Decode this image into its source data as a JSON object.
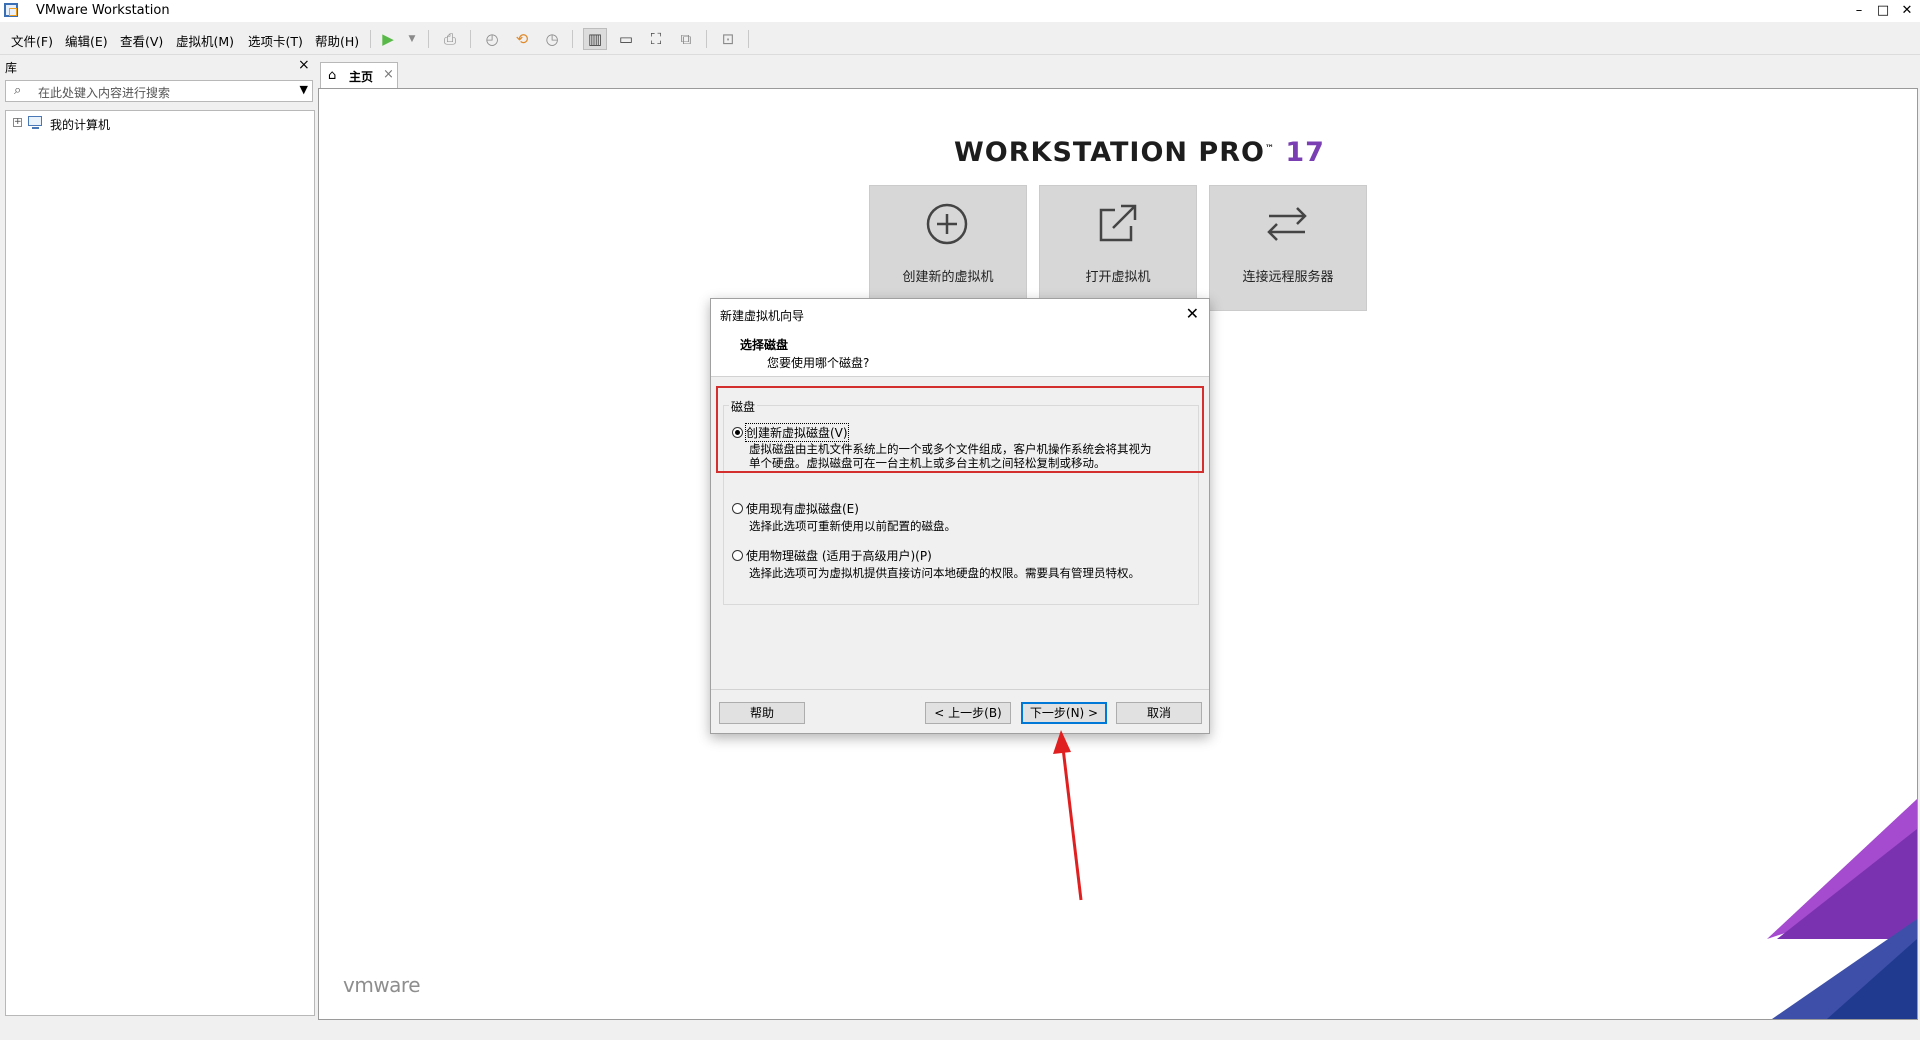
{
  "window": {
    "title": "VMware Workstation"
  },
  "window_controls": {
    "minimize": "–",
    "maximize": "□",
    "close": "✕"
  },
  "menu": [
    {
      "label": "文件(F)"
    },
    {
      "label": "编辑(E)"
    },
    {
      "label": "查看(V)"
    },
    {
      "label": "虚拟机(M)"
    },
    {
      "label": "选项卡(T)"
    },
    {
      "label": "帮助(H)"
    }
  ],
  "library": {
    "title": "库",
    "close": "×",
    "search_placeholder": "在此处键入内容进行搜索",
    "tree": [
      {
        "label": "我的计算机",
        "expander": "+"
      }
    ]
  },
  "tabs": [
    {
      "label": "主页",
      "close": "×"
    }
  ],
  "home": {
    "brand": "WORKSTATION PRO",
    "brand_tm": "™",
    "version": "17",
    "cards": [
      {
        "label": "创建新的虚拟机",
        "icon": "plus-circle-icon"
      },
      {
        "label": "打开虚拟机",
        "icon": "open-external-icon"
      },
      {
        "label": "连接远程服务器",
        "icon": "swap-arrows-icon"
      }
    ],
    "footer_logo": "vmware"
  },
  "dialog": {
    "title": "新建虚拟机向导",
    "close": "✕",
    "heading": "选择磁盘",
    "subheading": "您要使用哪个磁盘?",
    "group_label": "磁盘",
    "options": [
      {
        "label": "创建新虚拟磁盘(V)",
        "selected": true,
        "desc_line1": "虚拟磁盘由主机文件系统上的一个或多个文件组成，客户机操作系统会将其视为",
        "desc_line2": "单个硬盘。虚拟磁盘可在一台主机上或多台主机之间轻松复制或移动。"
      },
      {
        "label": "使用现有虚拟磁盘(E)",
        "selected": false,
        "desc_line1": "选择此选项可重新使用以前配置的磁盘。"
      },
      {
        "label": "使用物理磁盘 (适用于高级用户)(P)",
        "selected": false,
        "desc_line1": "选择此选项可为虚拟机提供直接访问本地硬盘的权限。需要具有管理员特权。"
      }
    ],
    "buttons": {
      "help": "帮助",
      "back": "< 上一步(B)",
      "next": "下一步(N) >",
      "cancel": "取消"
    }
  },
  "colors": {
    "brand_accent": "#7b3fb4",
    "highlight_box": "#d32f2f",
    "arrow": "#e02020",
    "default_button_border": "#0078d7"
  }
}
